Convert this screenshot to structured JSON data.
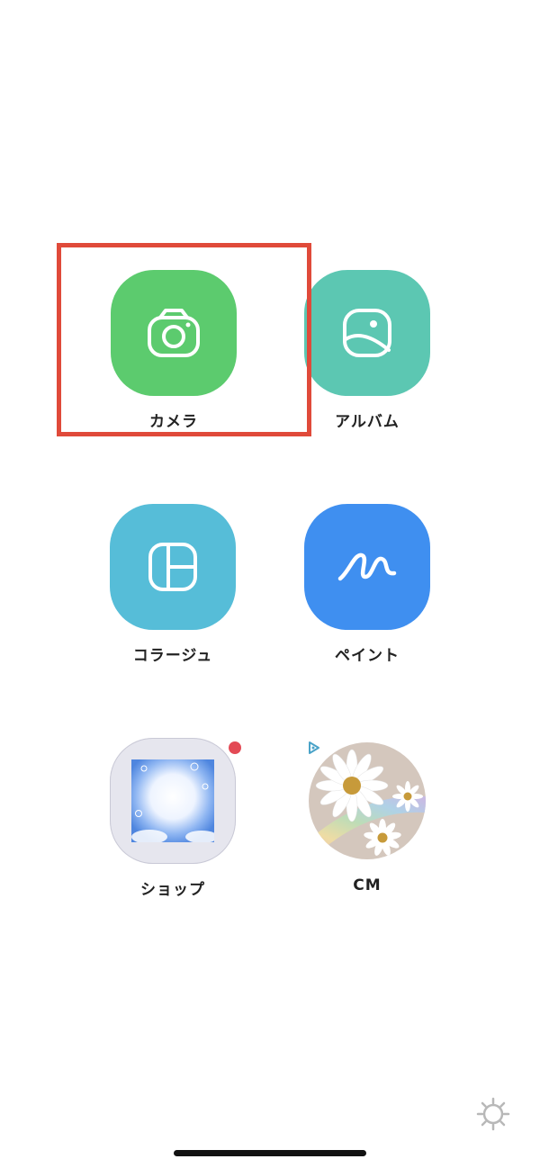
{
  "colors": {
    "camera": "#5ccb6e",
    "album": "#5cc7b2",
    "collage": "#56bdd8",
    "paint": "#3f8ff0",
    "shop_bg": "#e6e6ee",
    "highlight": "#e04a3a",
    "badge": "#e34a55",
    "ad_icon": "#4aa3c8"
  },
  "apps": {
    "camera": {
      "label": "カメラ",
      "icon": "camera-icon"
    },
    "album": {
      "label": "アルバム",
      "icon": "photo-album-icon"
    },
    "collage": {
      "label": "コラージュ",
      "icon": "collage-layout-icon"
    },
    "paint": {
      "label": "ペイント",
      "icon": "paint-scribble-icon"
    },
    "shop": {
      "label": "ショップ",
      "icon": "shop-frame-thumbnail"
    },
    "cm": {
      "label": "CM",
      "icon": "cm-daisy-thumbnail"
    }
  },
  "settings": {
    "icon": "settings-gear-icon"
  }
}
